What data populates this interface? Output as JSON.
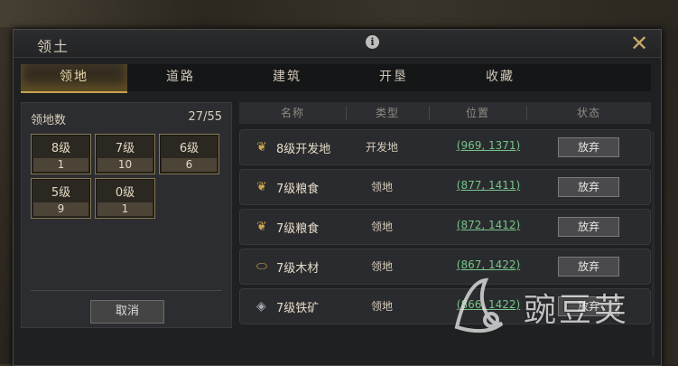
{
  "window": {
    "title": "领土",
    "info_icon": "info-icon",
    "close_icon": "close-x-icon"
  },
  "tabs": [
    {
      "label": "领地",
      "active": true
    },
    {
      "label": "道路",
      "active": false
    },
    {
      "label": "建筑",
      "active": false
    },
    {
      "label": "开垦",
      "active": false
    },
    {
      "label": "收藏",
      "active": false
    }
  ],
  "territory": {
    "count_label": "领地数",
    "count_value": "27/55",
    "levels": [
      {
        "name": "8级",
        "count": "1"
      },
      {
        "name": "7级",
        "count": "10"
      },
      {
        "name": "6级",
        "count": "6"
      },
      {
        "name": "5级",
        "count": "9"
      },
      {
        "name": "0级",
        "count": "1"
      }
    ],
    "cancel_label": "取消"
  },
  "table": {
    "headers": [
      "名称",
      "类型",
      "位置",
      "状态"
    ],
    "rows": [
      {
        "icon": "wheat-icon",
        "name": "8级开发地",
        "type": "开发地",
        "position": "(969, 1371)",
        "action": "放弃"
      },
      {
        "icon": "wheat-icon",
        "name": "7级粮食",
        "type": "领地",
        "position": "(877, 1411)",
        "action": "放弃"
      },
      {
        "icon": "wheat-icon",
        "name": "7级粮食",
        "type": "领地",
        "position": "(872, 1412)",
        "action": "放弃"
      },
      {
        "icon": "wood-icon",
        "name": "7级木材",
        "type": "领地",
        "position": "(867, 1422)",
        "action": "放弃"
      },
      {
        "icon": "iron-ore-icon",
        "name": "7级铁矿",
        "type": "领地",
        "position": "(866, 1422)",
        "action": "放弃"
      }
    ]
  },
  "watermark": {
    "text": "豌豆荚",
    "icon": "wandoujia-logo-icon"
  },
  "colors": {
    "accent": "#c8a14e",
    "position_link": "#78c48a",
    "panel": "#1f2022"
  }
}
